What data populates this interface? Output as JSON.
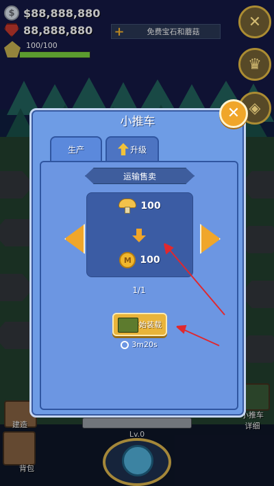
{
  "hud": {
    "money": "$88,888,880",
    "gems": "88,888,880",
    "energy": "100/100",
    "energy_level": 1.0,
    "free_offer": "免费宝石和蘑菇"
  },
  "bottom": {
    "left_label_1": "建造",
    "left_label_2": "背包",
    "right_label": "小推车\n详细",
    "level": "Lv.0"
  },
  "modal": {
    "title": "小推车",
    "tabs": [
      {
        "label": "生产",
        "active": true
      },
      {
        "label": "升级",
        "active": false
      }
    ],
    "section_label": "运输售卖",
    "input_amount": "100",
    "output_amount": "100",
    "page": "1/1",
    "start_button": "开始装载",
    "timer": "3m20s"
  },
  "colors": {
    "panel": "#6e9ce5",
    "accent_orange": "#f0a62a",
    "annotation_red": "#e0282e"
  },
  "icons": [
    "coin-icon",
    "gem-icon",
    "energy-icon",
    "close-icon",
    "upgrade-arrow-icon",
    "mushroom-icon",
    "gold-coin-icon",
    "down-arrow-icon",
    "cart-icon",
    "clock-icon"
  ]
}
